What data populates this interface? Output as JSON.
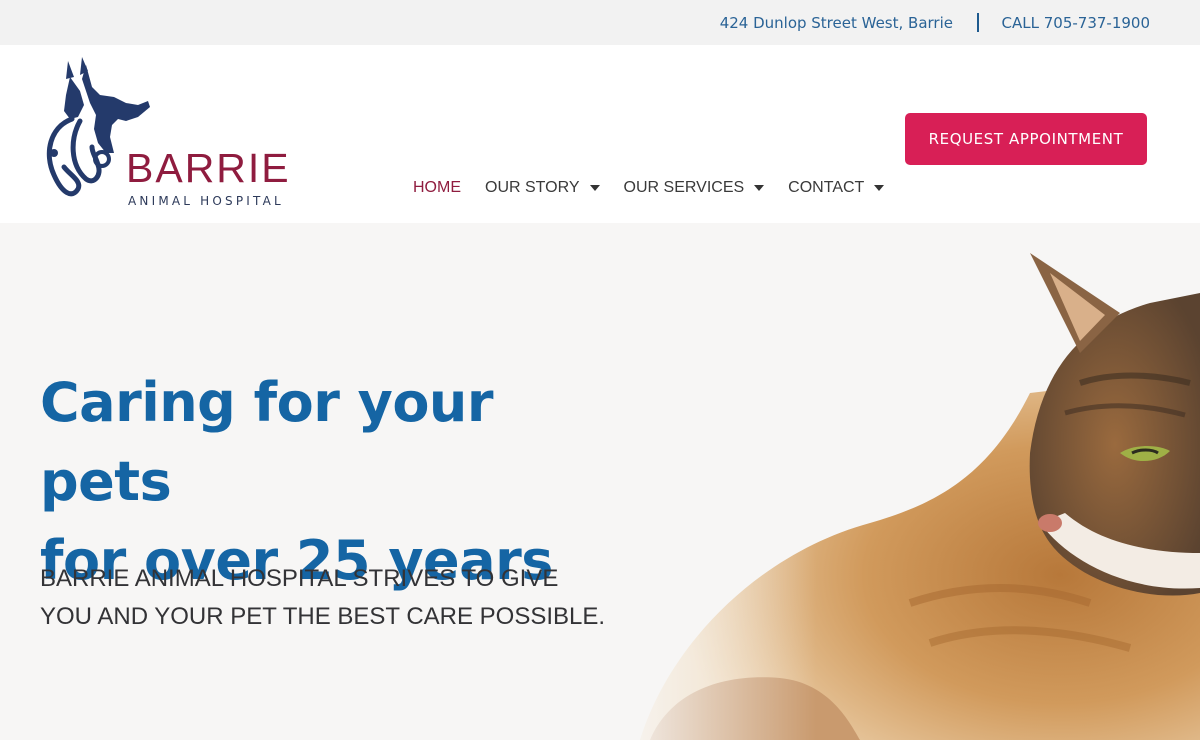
{
  "topbar": {
    "address": "424 Dunlop Street West, Barrie",
    "phone": "CALL 705-737-1900"
  },
  "logo": {
    "brand": "BARRIE",
    "subtitle": "ANIMAL HOSPITAL",
    "icon": "dog-cat-stethoscope-logo",
    "colors": {
      "brand": "#8f1c3f",
      "icon": "#243a6b"
    }
  },
  "cta": {
    "label": "REQUEST APPOINTMENT",
    "color": "#d81f56"
  },
  "nav": {
    "items": [
      {
        "label": "HOME",
        "active": true
      },
      {
        "label": "OUR STORY",
        "dropdown": true
      },
      {
        "label": "OUR SERVICES",
        "dropdown": true
      },
      {
        "label": "CONTACT",
        "dropdown": true
      }
    ]
  },
  "hero": {
    "headline_line1": "Caring for your pets",
    "headline_line2": "for over 25 years",
    "tagline_line1": "BARRIE ANIMAL HOSPITAL STRIVES TO GIVE",
    "tagline_line2": "YOU AND YOUR PET THE BEST CARE POSSIBLE.",
    "image": "tabby-cat-photo",
    "headline_color": "#1565a4"
  }
}
